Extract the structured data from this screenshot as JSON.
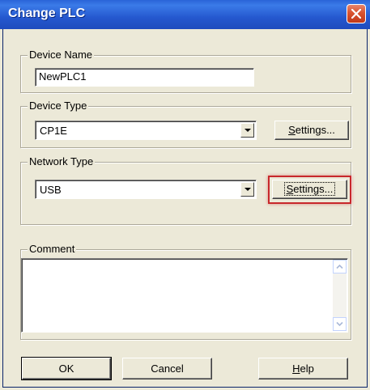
{
  "window": {
    "title": "Change PLC",
    "close_icon": "close-icon"
  },
  "device_name": {
    "legend": "Device Name",
    "value": "NewPLC1"
  },
  "device_type": {
    "legend": "Device Type",
    "selected": "CP1E",
    "settings_label_accel": "S",
    "settings_label_rest": "ettings..."
  },
  "network_type": {
    "legend": "Network Type",
    "selected": "USB",
    "settings_label_accel": "S",
    "settings_label_rest": "ettings...",
    "highlight_color": "#c8282b"
  },
  "comment": {
    "legend": "Comment",
    "value": ""
  },
  "buttons": {
    "ok": "OK",
    "cancel": "Cancel",
    "help_accel": "H",
    "help_rest": "elp"
  },
  "colors": {
    "title_bar": "#2558cf",
    "dialog_bg": "#ece9d8",
    "close_button": "#d9532f"
  }
}
